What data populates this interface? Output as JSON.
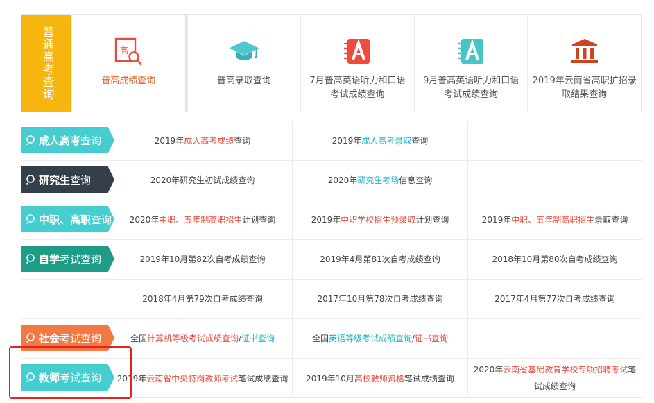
{
  "top": {
    "label": "普通高考查询",
    "cards": [
      {
        "text": "普高成绩查询",
        "icon": "search-score-icon"
      },
      {
        "text": "普高录取查询",
        "icon": "graduation-cap-icon"
      },
      {
        "text": "7月普高英语听力和口语考试成绩查询",
        "icon": "letter-a-notebook-icon"
      },
      {
        "text": "9月普高英语听力和口语考试成绩查询",
        "icon": "letter-a-notebook-icon"
      },
      {
        "text": "2019年云南省高职扩招录取结果查询",
        "icon": "building-icon"
      }
    ],
    "icon_text": "高"
  },
  "rows": [
    {
      "badge": {
        "bold": "成人高考",
        "lite": "查询"
      },
      "cells": [
        {
          "a": "2019年",
          "b": "成人高考成绩",
          "c": "查询"
        },
        {
          "a": "2019年",
          "b": "成人高考录取",
          "c": "查询"
        },
        {
          "a": "",
          "b": "",
          "c": ""
        }
      ]
    },
    {
      "badge": {
        "bold": "研究生",
        "lite": "查询"
      },
      "cells": [
        {
          "a": "2020年研究生初试成绩查询",
          "b": "",
          "c": ""
        },
        {
          "a": "2020年",
          "b": "研究生考场",
          "c": "信息查询"
        },
        {
          "a": "",
          "b": "",
          "c": ""
        }
      ]
    },
    {
      "badge": {
        "bold": "中职、高职",
        "lite": "查询"
      },
      "cells": [
        {
          "a": "2020年",
          "b": "中职、五年制高职招生",
          "c": "计划查询"
        },
        {
          "a": "2019年",
          "b": "中职学校招生预录取",
          "c": "计划查询"
        },
        {
          "a": "2019年",
          "b": "中职、五年制高职招生",
          "c": "录取查询"
        }
      ]
    },
    {
      "badge": {
        "bold": "自学",
        "lite": "考试查询"
      },
      "cells": [
        {
          "a": "2019年10月第82次自考成绩查询",
          "b": "",
          "c": ""
        },
        {
          "a": "2019年4月第81次自考成绩查询",
          "b": "",
          "c": ""
        },
        {
          "a": "2018年10月第80次自考成绩查询",
          "b": "",
          "c": ""
        }
      ]
    },
    {
      "badge": null,
      "cells": [
        {
          "a": "2018年4月第79次自考成绩查询",
          "b": "",
          "c": ""
        },
        {
          "a": "2017年10月第78次自考成绩查询",
          "b": "",
          "c": ""
        },
        {
          "a": "2017年4月第77次自考成绩查询",
          "b": "",
          "c": ""
        }
      ]
    },
    {
      "badge": {
        "bold": "社会",
        "lite": "考试查询"
      },
      "cells": [
        {
          "a": "全国",
          "b": "计算机等级考试成绩查询",
          "c": " / ",
          "d": "证书查询"
        },
        {
          "a": "全国",
          "b": "英语等级考试成绩查询",
          "c": " / ",
          "d": "证书查询"
        },
        {
          "a": "",
          "b": "",
          "c": "",
          "d": ""
        }
      ]
    },
    {
      "badge": {
        "bold": "教师",
        "lite": "考试查询"
      },
      "cells": [
        {
          "a": "2019年",
          "b": "云南省中央特岗教师考试",
          "c": "笔试成绩查询"
        },
        {
          "a": "2019年10月",
          "b": "高校教师资格",
          "c": "笔试成绩查询"
        },
        {
          "a": "2020年",
          "b": "云南省基础教育学校专项招聘考试",
          "c": "笔试成绩查询"
        }
      ]
    }
  ],
  "colors": {
    "yellow": "#f6b60f",
    "teal": "#46cdd0",
    "dark": "#353f4b",
    "green": "#1e9c86",
    "orange": "#f37944",
    "highlight": "#e84c3d",
    "cyan": "#1fb6c6"
  }
}
